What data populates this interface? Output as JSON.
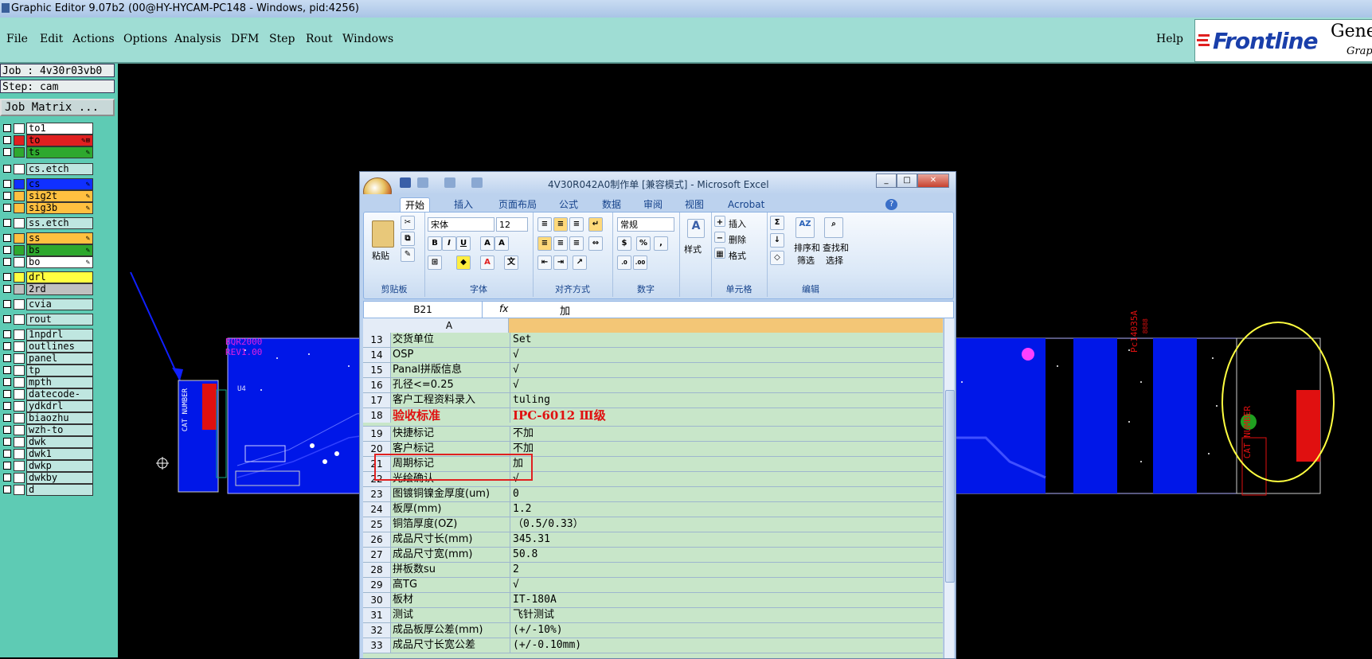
{
  "titlebar": {
    "title": "Graphic Editor 9.07b2 (00@HY-HYCAM-PC148 - Windows, pid:4256)"
  },
  "menubar": {
    "items": [
      "File",
      "Edit",
      "Actions",
      "Options",
      "Analysis",
      "DFM",
      "Step",
      "Rout",
      "Windows"
    ],
    "help": "Help"
  },
  "logo": {
    "brand": "Frontline",
    "gene": "Gene",
    "grap": "Grap"
  },
  "job": {
    "job_label": "Job : 4v30r03vb0",
    "step_label": "Step: cam",
    "matrix_button": "Job Matrix ..."
  },
  "layers": [
    {
      "name": "to1",
      "color": "#ffffff",
      "edit": ""
    },
    {
      "name": "to",
      "color": "#e02020",
      "edit": "✎⊞"
    },
    {
      "name": "ts",
      "color": "#2ea82e",
      "edit": "✎"
    },
    {
      "name": "cs.etch",
      "color": "",
      "edit": ""
    },
    {
      "name": "cs",
      "color": "#1030ff",
      "edit": "✎"
    },
    {
      "name": "sig2t",
      "color": "#ffc040",
      "edit": "✎"
    },
    {
      "name": "sig3b",
      "color": "#ffc040",
      "edit": "✎"
    },
    {
      "name": "ss.etch",
      "color": "",
      "edit": ""
    },
    {
      "name": "ss",
      "color": "#ffc040",
      "edit": "✎"
    },
    {
      "name": "bs",
      "color": "#2ea82e",
      "edit": "✎"
    },
    {
      "name": "bo",
      "color": "#ffffff",
      "edit": "✎"
    },
    {
      "name": "drl",
      "color": "#ffff40",
      "edit": ""
    },
    {
      "name": "2rd",
      "color": "#c0c0c0",
      "edit": ""
    },
    {
      "name": "cvia",
      "color": "",
      "edit": ""
    },
    {
      "name": "rout",
      "color": "",
      "edit": ""
    },
    {
      "name": "1npdrl",
      "color": "",
      "edit": ""
    },
    {
      "name": "outlines",
      "color": "",
      "edit": ""
    },
    {
      "name": "panel",
      "color": "",
      "edit": ""
    },
    {
      "name": "tp",
      "color": "",
      "edit": ""
    },
    {
      "name": "mpth",
      "color": "",
      "edit": ""
    },
    {
      "name": "datecode-ptc",
      "color": "",
      "edit": ""
    },
    {
      "name": "ydkdrl",
      "color": "",
      "edit": ""
    },
    {
      "name": "biaozhu",
      "color": "",
      "edit": ""
    },
    {
      "name": "wzh-to",
      "color": "",
      "edit": ""
    },
    {
      "name": "dwk",
      "color": "",
      "edit": ""
    },
    {
      "name": "dwk1",
      "color": "",
      "edit": ""
    },
    {
      "name": "dwkp",
      "color": "",
      "edit": ""
    },
    {
      "name": "dwkby",
      "color": "",
      "edit": ""
    },
    {
      "name": "d",
      "color": "",
      "edit": ""
    }
  ],
  "pcb": {
    "bqr": "BQR2000",
    "rev": "REV1.00",
    "cat": "CAT NUMBER",
    "pc": "Pc14035A",
    "code": "8888",
    "u4": "U4"
  },
  "excel": {
    "title": "4V30R042A0制作单 [兼容模式] - Microsoft Excel",
    "tabs": [
      "开始",
      "插入",
      "页面布局",
      "公式",
      "数据",
      "审阅",
      "视图",
      "Acrobat"
    ],
    "ribbon": {
      "paste": "粘贴",
      "clipboard": "剪贴板",
      "font_name": "宋体",
      "font_size": "12",
      "font": "字体",
      "align": "对齐方式",
      "number_format": "常规",
      "number": "数字",
      "style": "样式",
      "insert": "插入",
      "delete": "删除",
      "format": "格式",
      "cells": "单元格",
      "sort": "排序和",
      "sort2": "筛选",
      "find": "查找和",
      "find2": "选择",
      "editing": "编辑",
      "percent": "%",
      "comma": ","
    },
    "namebox": "B21",
    "fx": "fx",
    "formula": "加",
    "col_a": "A",
    "rows": [
      {
        "n": "13",
        "a": "交货单位",
        "b": "Set"
      },
      {
        "n": "14",
        "a": "OSP",
        "b": "√"
      },
      {
        "n": "15",
        "a": "Panal拼版信息",
        "b": "√"
      },
      {
        "n": "16",
        "a": "孔径<=0.25",
        "b": "√"
      },
      {
        "n": "17",
        "a": "客户工程资料录入",
        "b": "tuling"
      },
      {
        "n": "18",
        "a": "验收标准",
        "b": "IPC-6012 Ⅲ级",
        "bold": true
      },
      {
        "n": "19",
        "a": "快捷标记",
        "b": "不加"
      },
      {
        "n": "20",
        "a": "客户标记",
        "b": "不加"
      },
      {
        "n": "21",
        "a": "周期标记",
        "b": "加"
      },
      {
        "n": "22",
        "a": "光绘确认",
        "b": "√"
      },
      {
        "n": "23",
        "a": "图镀铜镍金厚度(um)",
        "b": "0"
      },
      {
        "n": "24",
        "a": "板厚(mm)",
        "b": "1.2"
      },
      {
        "n": "25",
        "a": "铜箔厚度(OZ)",
        "b": "（0.5/0.33）"
      },
      {
        "n": "26",
        "a": "成品尺寸长(mm)",
        "b": "345.31"
      },
      {
        "n": "27",
        "a": "成品尺寸宽(mm)",
        "b": "50.8"
      },
      {
        "n": "28",
        "a": "拼板数su",
        "b": "2"
      },
      {
        "n": "29",
        "a": "高TG",
        "b": "√"
      },
      {
        "n": "30",
        "a": "板材",
        "b": "IT-180A"
      },
      {
        "n": "31",
        "a": "测试",
        "b": "飞针测试"
      },
      {
        "n": "32",
        "a": "成品板厚公差(mm)",
        "b": "(+/-10%)"
      },
      {
        "n": "33",
        "a": "成品尺寸长宽公差",
        "b": "(+/-0.10mm)"
      }
    ]
  }
}
